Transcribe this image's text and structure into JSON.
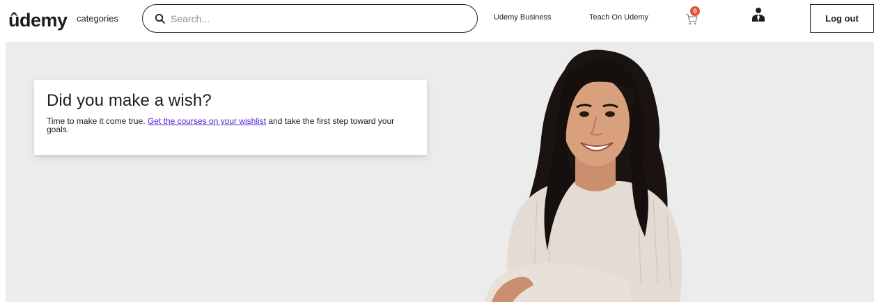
{
  "header": {
    "logo_text": "ûdemy",
    "categories_label": "categories",
    "search": {
      "placeholder": "Search..."
    },
    "nav": {
      "business": "Udemy Business",
      "teach": "Teach On Udemy"
    },
    "cart": {
      "count": "0",
      "icon": "cart-icon"
    },
    "user_icon": "user-icon",
    "logout_label": "Log out"
  },
  "hero": {
    "title": "Did you make a wish?",
    "body_before": "Time to make it come true. ",
    "link_text": "Get the courses on your wishlist",
    "body_after": " and take the first step toward your goals."
  },
  "colors": {
    "accent": "#5624d0",
    "hero_bg": "#ececec",
    "badge": "#e0503b",
    "text": "#1c1d1f"
  }
}
